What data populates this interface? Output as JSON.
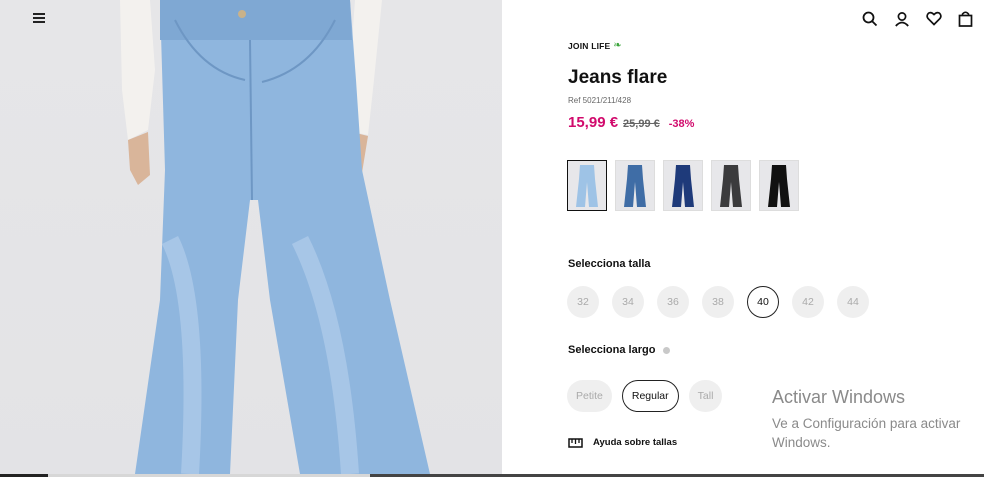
{
  "header": {
    "menu_icon": "hamburger-menu-icon",
    "icons": [
      "search-icon",
      "user-icon",
      "heart-icon",
      "shopping-bag-icon"
    ]
  },
  "product": {
    "tag": "JOIN LIFE",
    "tag_icon": "leaf-icon",
    "title": "Jeans flare",
    "ref": "Ref 5021/211/428",
    "price_current": "15,99 €",
    "price_old": "25,99 €",
    "discount": "-38%",
    "accent_color": "#d10a6c"
  },
  "colors": [
    {
      "name": "light-blue",
      "hex": "#9ec3e6",
      "selected": true
    },
    {
      "name": "mid-blue",
      "hex": "#3f6da6",
      "selected": false
    },
    {
      "name": "dark-blue",
      "hex": "#1e3a7a",
      "selected": false
    },
    {
      "name": "dark-grey",
      "hex": "#3b3b3d",
      "selected": false
    },
    {
      "name": "black",
      "hex": "#111111",
      "selected": false
    }
  ],
  "size_section": {
    "label": "Selecciona talla",
    "sizes": [
      "32",
      "34",
      "36",
      "38",
      "40",
      "42",
      "44"
    ],
    "selected": "40"
  },
  "length_section": {
    "label": "Selecciona largo",
    "info_icon": "info-icon",
    "options": [
      "Petite",
      "Regular",
      "Tall"
    ],
    "selected": "Regular"
  },
  "size_guide": {
    "label": "Ayuda sobre tallas",
    "icon": "ruler-icon"
  },
  "watermark": {
    "title": "Activar Windows",
    "subtitle": "Ve a Configuración para activar Windows."
  }
}
